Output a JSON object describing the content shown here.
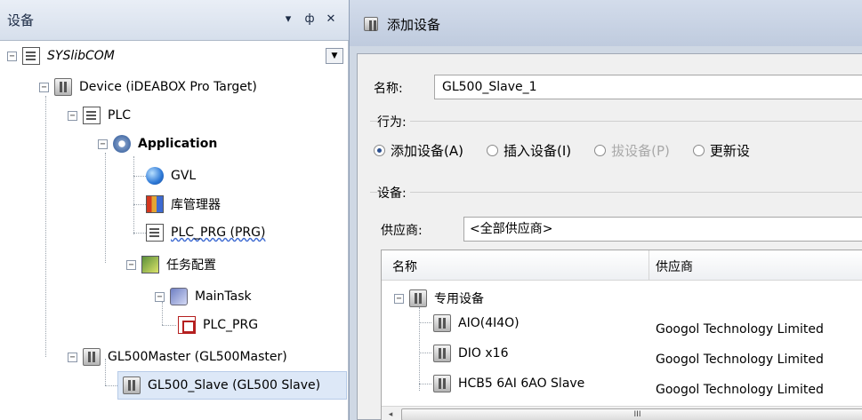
{
  "panel": {
    "title": "设备",
    "dropdown_glyph": "▾",
    "pin_glyph": "ф",
    "close_glyph": "✕"
  },
  "tree": {
    "root": "SYSlibCOM",
    "device": "Device (iDEABOX Pro Target)",
    "plc": "PLC",
    "application": "Application",
    "gvl": "GVL",
    "library": "库管理器",
    "plc_prg": "PLC_PRG (PRG)",
    "task_config": "任务配置",
    "main_task": "MainTask",
    "task_prg": "PLC_PRG",
    "gl500_master": "GL500Master (GL500Master)",
    "gl500_slave": "GL500_Slave (GL500 Slave)"
  },
  "dialog": {
    "title": "添加设备",
    "name_label": "名称:",
    "name_value": "GL500_Slave_1",
    "action_label": "行为:",
    "radios": {
      "add": "添加设备(A)",
      "insert": "插入设备(I)",
      "plug": "拔设备(P)",
      "update": "更新设"
    },
    "device_label": "设备:",
    "vendor_label": "供应商:",
    "vendor_value": "<全部供应商>",
    "columns": {
      "name": "名称",
      "vendor": "供应商"
    },
    "group": "专用设备",
    "rows": [
      {
        "name": "AIO(4I4O)",
        "vendor": "Googol Technology Limited"
      },
      {
        "name": "DIO x16",
        "vendor": "Googol Technology Limited"
      },
      {
        "name": "HCB5 6AI 6AO Slave",
        "vendor": "Googol Technology Limited"
      }
    ],
    "scroll_left_glyph": "◂",
    "scroll_thumb_glyph": "III"
  },
  "colors": {
    "selection": "#dde8f7",
    "titlebar": "#d6dfec",
    "dialog_bg": "#f0f0f0",
    "radio_dot": "#2a4f8f"
  }
}
